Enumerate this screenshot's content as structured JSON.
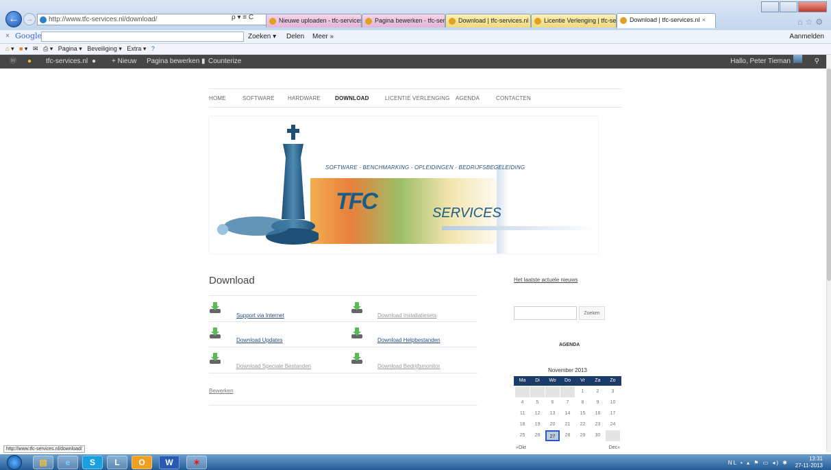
{
  "browser": {
    "address_url": "http://www.tfc-services.nl/download/",
    "address_buttons": "ρ ▾ ≡ C",
    "tabs": [
      "Nieuwe uploaden - tfc-services...",
      "Pagina bewerken - tfc-services...",
      "Download | tfc-services.nl",
      "Licentie Verlenging | tfc-servic...",
      "Download | tfc-services.nl"
    ],
    "tab_close": "×"
  },
  "google_bar": {
    "logo": "Google",
    "close": "×",
    "search_button": "Zoeken ▾",
    "share_button": "Delen",
    "more_button": "Meer »",
    "signin": "Aanmelden"
  },
  "command_bar": {
    "items": [
      "Pagina ▾",
      "Beveiliging ▾",
      "Extra ▾"
    ]
  },
  "wp_admin_bar": {
    "site_name": "tfc-services.nl",
    "new_label": "+ Nieuw",
    "edit_page": "Pagina bewerken",
    "counterize": "Counterize",
    "greeting": "Hallo, Peter Tieman"
  },
  "site_nav": [
    "HOME",
    "SOFTWARE",
    "HARDWARE",
    "DOWNLOAD",
    "LICENTIE VERLENGING",
    "AGENDA",
    "CONTACTEN"
  ],
  "banner": {
    "tagline": "SOFTWARE - BENCHMARKING - OPLEIDINGEN - BEDRIJFSBEGELEIDING",
    "brand": "TFC",
    "brand_suffix": "SERVICES"
  },
  "content": {
    "title": "Download",
    "links": [
      "Support via Internet",
      "Download Installatiesets",
      "Download Updates",
      "Download Helpbestanden",
      "Download Speciale Bestanden",
      "Download Bedrijfsmonitor"
    ],
    "edit_link": "Bewerken"
  },
  "sidebar": {
    "news_link": "Het laatste actuele nieuws",
    "search_button": "Zoeken",
    "agenda_title": "AGENDA",
    "calendar": {
      "month": "November 2013",
      "weekdays": [
        "Ma",
        "Di",
        "Wo",
        "Do",
        "Vr",
        "Za",
        "Zo"
      ],
      "rows": [
        [
          "",
          "",
          "",
          "",
          "1",
          "2",
          "3"
        ],
        [
          "4",
          "5",
          "6",
          "7",
          "8",
          "9",
          "10"
        ],
        [
          "11",
          "12",
          "13",
          "14",
          "15",
          "16",
          "17"
        ],
        [
          "18",
          "19",
          "20",
          "21",
          "22",
          "23",
          "24"
        ],
        [
          "25",
          "26",
          "27",
          "28",
          "29",
          "30",
          ""
        ]
      ],
      "today": "27",
      "prev": "«Okt",
      "next": "Dec»"
    }
  },
  "status_bar": {
    "url": "http://www.tfc-services.nl/download/"
  },
  "taskbar": {
    "time": "13:31",
    "date": "27-11-2013",
    "lang": "NL"
  },
  "colors": {
    "wp_bar": "#464646",
    "brand_blue": "#1b5c86",
    "calendar_header": "#1d3b68"
  }
}
